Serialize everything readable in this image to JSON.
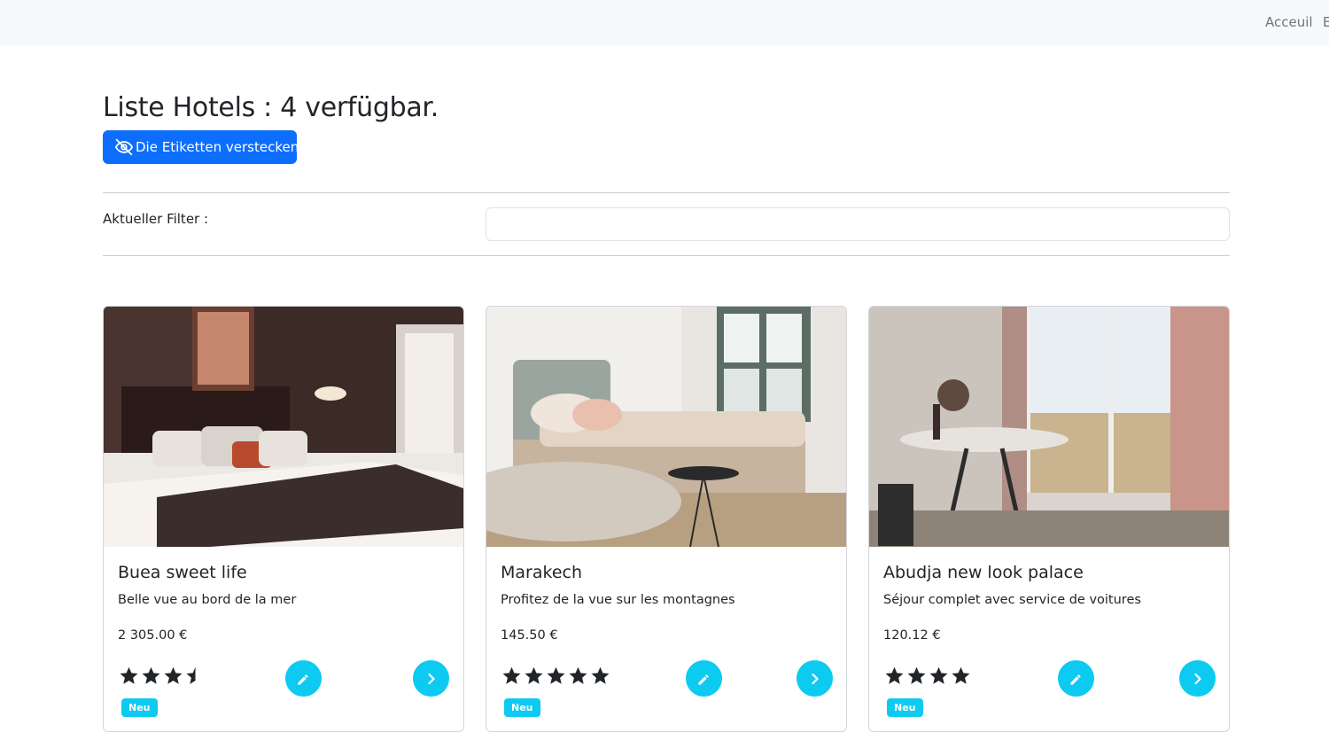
{
  "nav": {
    "home_label": "Acceuil",
    "next_label_partial": "E"
  },
  "header": {
    "title": "Liste Hotels : 4 verfügbar.",
    "toggle_button_label": "Die Etiketten verstecken",
    "toggle_button_icon": "eye-slash-icon"
  },
  "filter": {
    "label": "Aktueller Filter :",
    "value": ""
  },
  "colors": {
    "primary": "#0d6efd",
    "info": "#0dcaf0",
    "navbar_bg": "#f8f9fa",
    "text": "#212529"
  },
  "hotels": [
    {
      "name": "Buea sweet life",
      "description": "Belle vue au bord de la mer",
      "price": "2 305.00 €",
      "rating": 3.5,
      "badge": "Neu",
      "image": "hotel-room-bedroom-photo"
    },
    {
      "name": "Marakech",
      "description": "Profitez de la vue sur les montagnes",
      "price": "145.50 €",
      "rating": 5,
      "badge": "Neu",
      "image": "bright-bedroom-photo"
    },
    {
      "name": "Abudja new look palace",
      "description": "Séjour complet avec service de voitures",
      "price": "120.12 €",
      "rating": 4,
      "badge": "Neu",
      "image": "dining-room-with-view-photo"
    }
  ]
}
